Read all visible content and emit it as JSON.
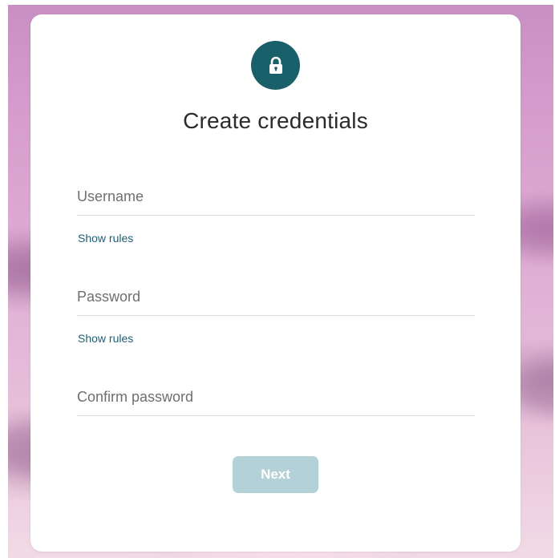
{
  "card": {
    "title": "Create credentials"
  },
  "icons": {
    "lock": "lock-icon"
  },
  "fields": {
    "username": {
      "value": "",
      "placeholder": "Username"
    },
    "password": {
      "value": "",
      "placeholder": "Password"
    },
    "confirm_password": {
      "value": "",
      "placeholder": "Confirm password"
    }
  },
  "links": {
    "username_rules": "Show rules",
    "password_rules": "Show rules"
  },
  "actions": {
    "next_label": "Next"
  },
  "colors": {
    "accent": "#19606a",
    "link": "#1e5f73",
    "button_disabled": "#b3d1d6"
  }
}
